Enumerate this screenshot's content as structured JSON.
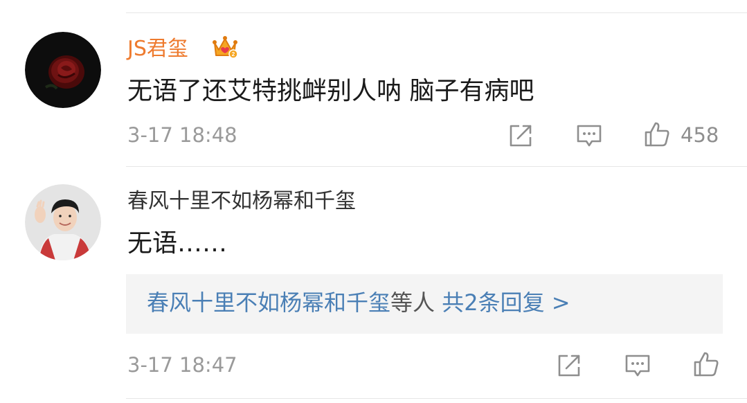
{
  "comments": [
    {
      "username": "JS君玺",
      "content": "无语了还艾特挑衅别人呐   脑子有病吧",
      "timestamp": "3-17 18:48",
      "likes": "458"
    },
    {
      "username": "春风十里不如杨幂和千玺",
      "content": "无语……",
      "timestamp": "3-17 18:47",
      "likes": ""
    }
  ],
  "reply_preview": {
    "users": "春风十里不如杨幂和千玺",
    "suffix": "等人",
    "count_text": "共2条回复 >"
  },
  "colors": {
    "vip_name": "#ee7b2f",
    "link": "#4a7fb5",
    "meta": "#9a9a9a"
  },
  "icons": [
    "vip-crown-icon",
    "share-icon",
    "comment-icon",
    "like-icon"
  ]
}
